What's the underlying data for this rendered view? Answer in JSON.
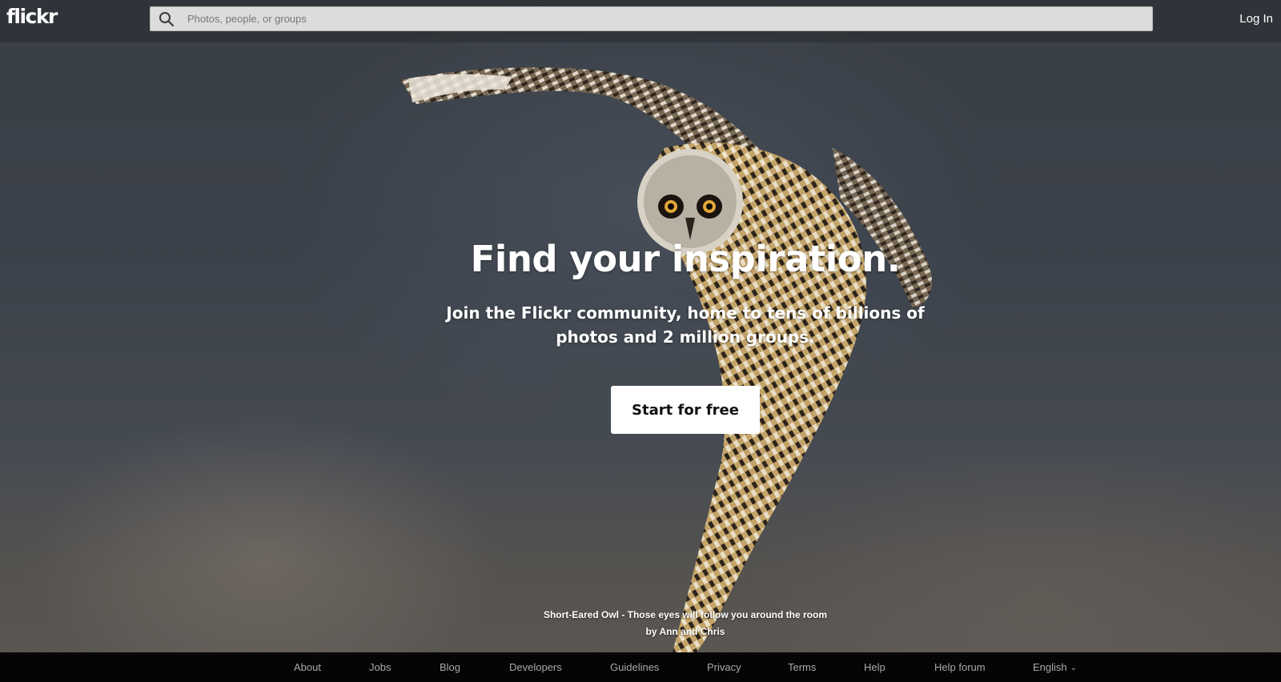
{
  "header": {
    "logo": "flickr",
    "search_placeholder": "Photos, people, or groups",
    "login_label": "Log In"
  },
  "hero": {
    "headline": "Find your inspiration.",
    "subline_1": "Join the Flickr community, home to tens of billions of",
    "subline_2": "photos and 2 million groups.",
    "cta_label": "Start for free",
    "photo_title": "Short-Eared Owl - Those eyes will follow you around the room",
    "photo_author": "by Ann and Chris"
  },
  "footer": {
    "links": [
      "About",
      "Jobs",
      "Blog",
      "Developers",
      "Guidelines",
      "Privacy",
      "Terms",
      "Help",
      "Help forum"
    ],
    "language": "English"
  },
  "colors": {
    "topbar": "#2a2d32",
    "footer": "#050505",
    "cta_bg": "#ffffff",
    "search_bg": "#dcdcdc"
  }
}
